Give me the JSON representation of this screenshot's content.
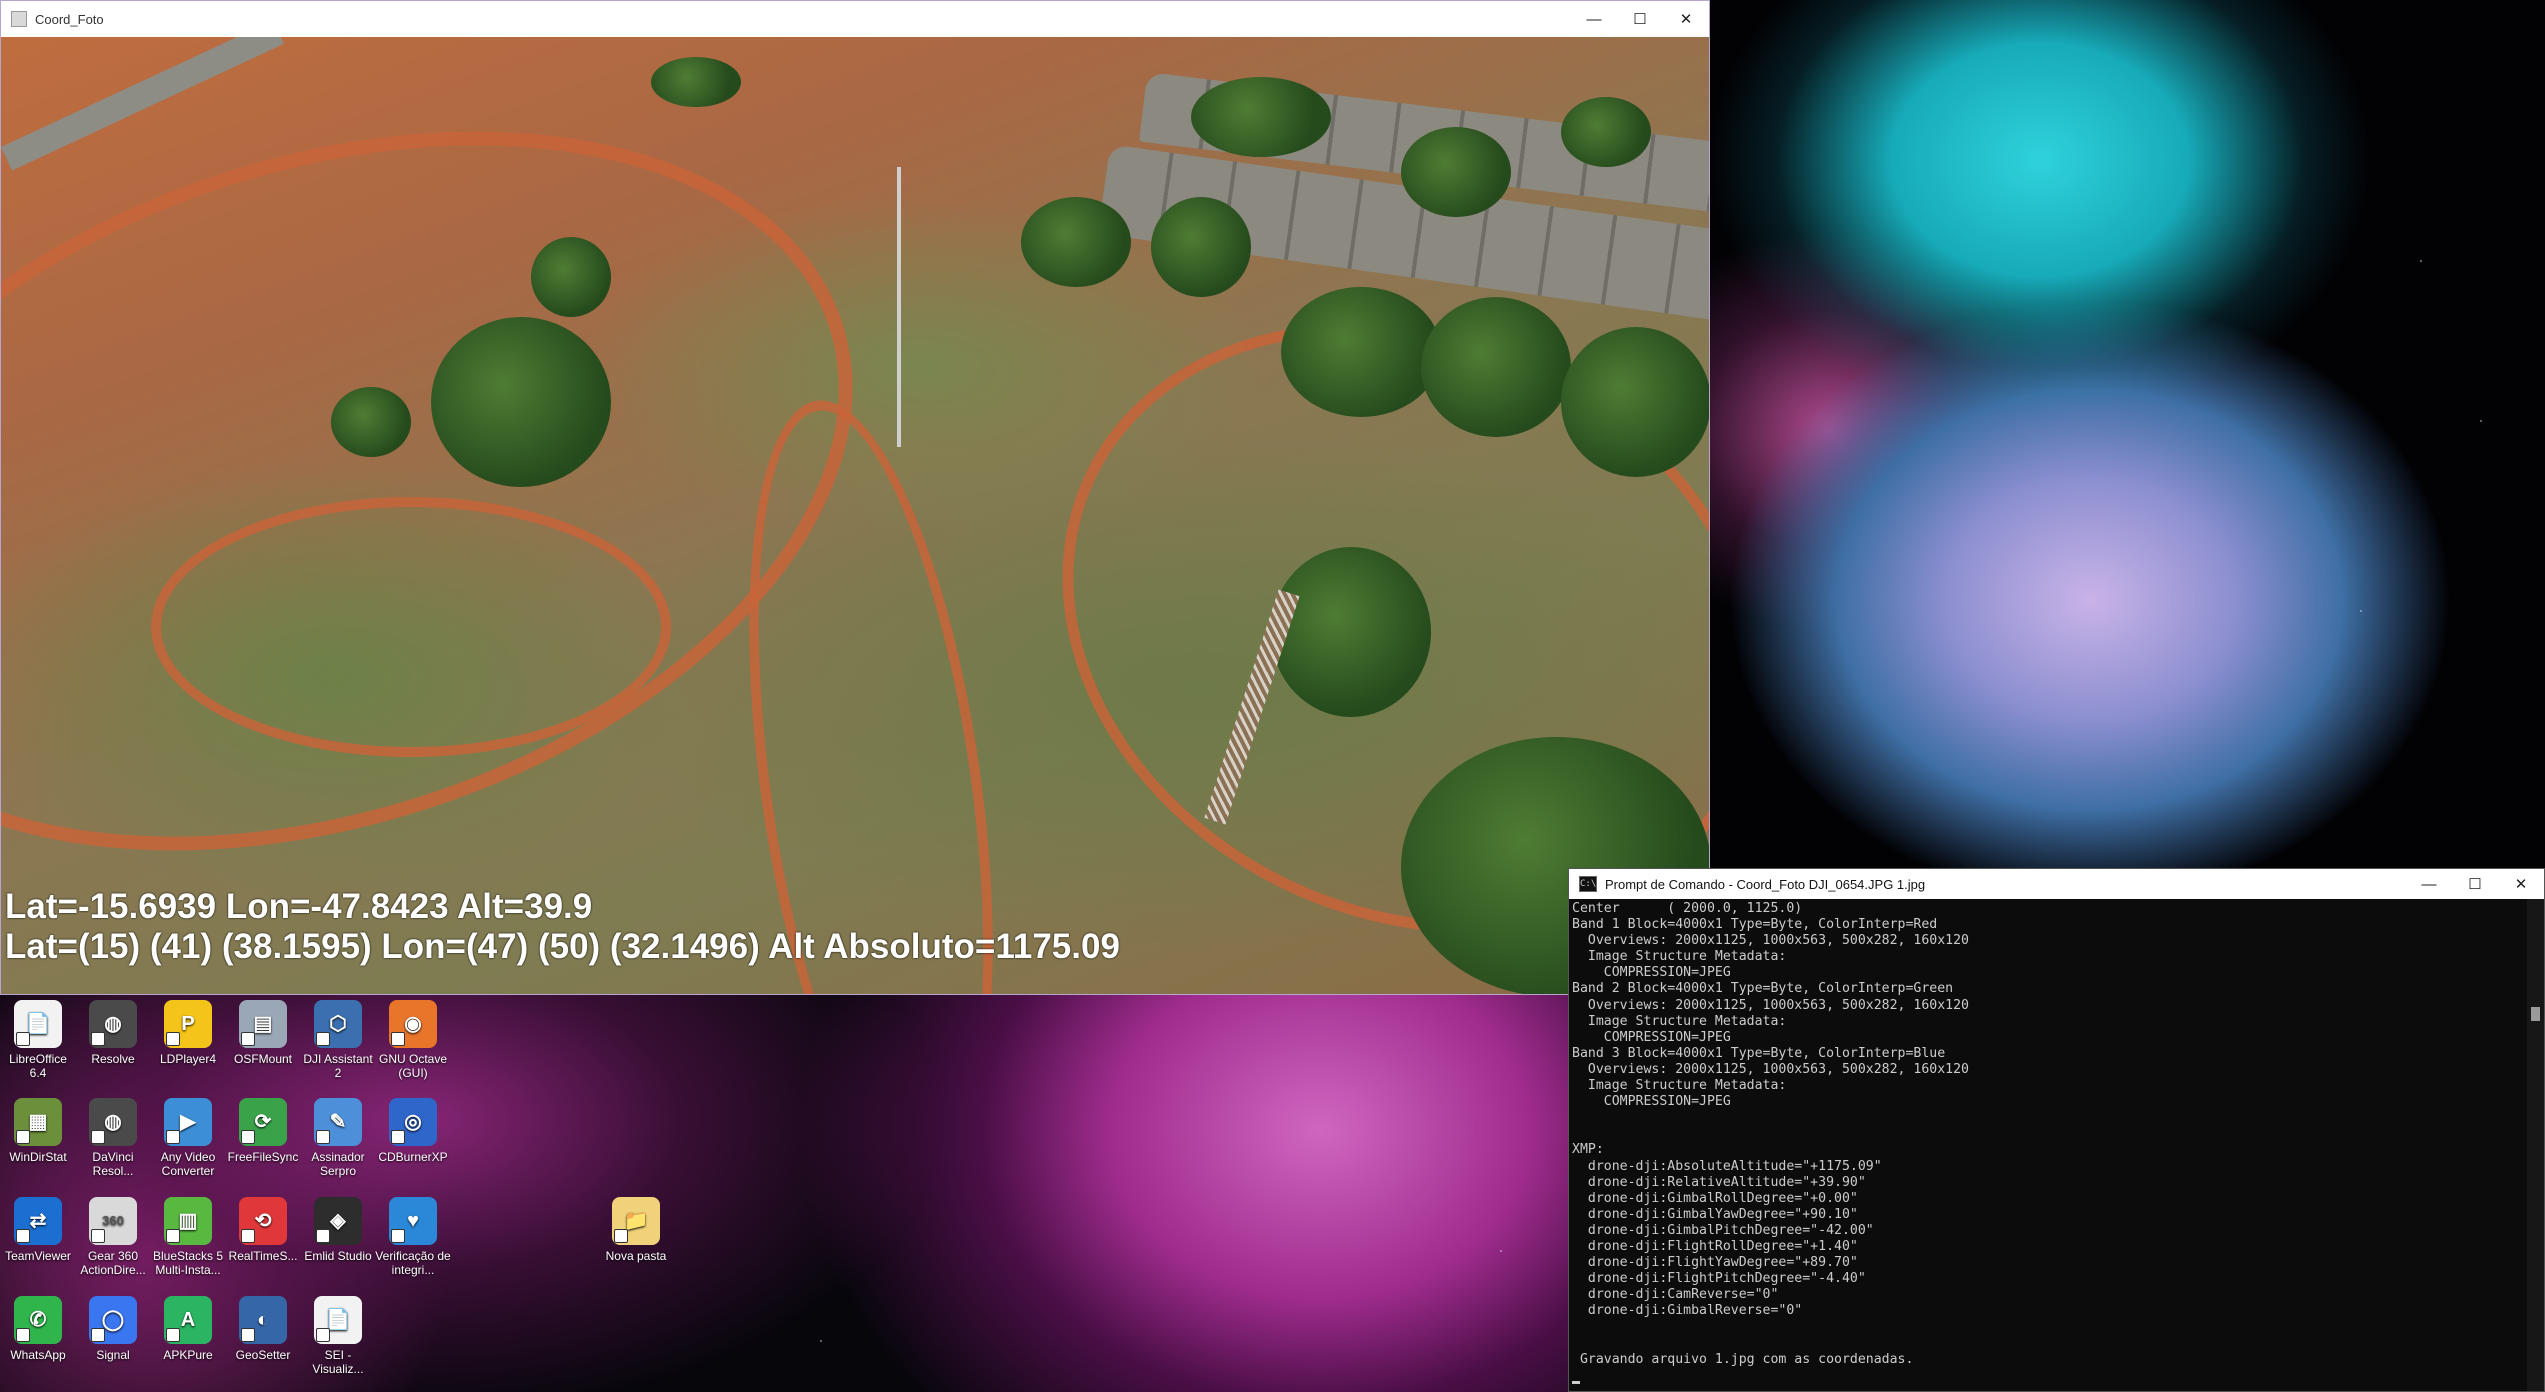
{
  "photo_window": {
    "title": "Coord_Foto",
    "overlay_line1": "Lat=-15.6939 Lon=-47.8423 Alt=39.9",
    "overlay_line2": "Lat=(15) (41) (38.1595) Lon=(47) (50) (32.1496) Alt Absoluto=1175.09"
  },
  "window_controls": {
    "minimize": "—",
    "maximize": "☐",
    "close": "✕"
  },
  "desktop_icons": [
    {
      "label": "LibreOffice 6.4",
      "name": "libreoffice-icon",
      "color": "#f2f2f2",
      "glyph": "📄"
    },
    {
      "label": "Resolve",
      "name": "resolve-icon",
      "color": "#4a4a4a",
      "glyph": "◍"
    },
    {
      "label": "LDPlayer4",
      "name": "ldplayer-icon",
      "color": "#f4c41a",
      "glyph": "P"
    },
    {
      "label": "OSFMount",
      "name": "osfmount-icon",
      "color": "#9aa7b6",
      "glyph": "▤"
    },
    {
      "label": "DJI Assistant 2",
      "name": "dji-assistant-icon",
      "color": "#3b6fb0",
      "glyph": "⬡"
    },
    {
      "label": "GNU Octave (GUI)",
      "name": "gnu-octave-icon",
      "color": "#e8752a",
      "glyph": "◉"
    },
    {
      "label": "WinDirStat",
      "name": "windirstat-icon",
      "color": "#6b8f3a",
      "glyph": "▦"
    },
    {
      "label": "DaVinci Resol...",
      "name": "davinci-resolve-icon",
      "color": "#4a4a4a",
      "glyph": "◍"
    },
    {
      "label": "Any Video Converter",
      "name": "any-video-converter-icon",
      "color": "#3c8fd6",
      "glyph": "▶"
    },
    {
      "label": "FreeFileSync",
      "name": "freefilesync-icon",
      "color": "#3aa34a",
      "glyph": "⟳"
    },
    {
      "label": "Assinador Serpro",
      "name": "assinador-serpro-icon",
      "color": "#4d8fd8",
      "glyph": "✎"
    },
    {
      "label": "CDBurnerXP",
      "name": "cdburnerxp-icon",
      "color": "#2f66c9",
      "glyph": "◎"
    },
    {
      "label": "TeamViewer",
      "name": "teamviewer-icon",
      "color": "#1b6fd1",
      "glyph": "⇄"
    },
    {
      "label": "Gear 360 ActionDire...",
      "name": "gear360-icon",
      "color": "#d9d9d9",
      "glyph": "360"
    },
    {
      "label": "BlueStacks 5 Multi-Insta...",
      "name": "bluestacks-icon",
      "color": "#58b840",
      "glyph": "▥"
    },
    {
      "label": "RealTimeS...",
      "name": "realtimesync-icon",
      "color": "#e0383a",
      "glyph": "⟲"
    },
    {
      "label": "Emlid Studio",
      "name": "emlid-studio-icon",
      "color": "#2d2d2d",
      "glyph": "◈"
    },
    {
      "label": "Verificação de integri...",
      "name": "verificacao-integridade-icon",
      "color": "#2b88d8",
      "glyph": "♥"
    },
    {
      "label": "WhatsApp",
      "name": "whatsapp-icon",
      "color": "#2fb54c",
      "glyph": "✆"
    },
    {
      "label": "Signal",
      "name": "signal-icon",
      "color": "#3a76f0",
      "glyph": "◯"
    },
    {
      "label": "APKPure",
      "name": "apkpure-icon",
      "color": "#2bb462",
      "glyph": "A"
    },
    {
      "label": "GeoSetter",
      "name": "geosetter-icon",
      "color": "#3566a8",
      "glyph": "◐"
    },
    {
      "label": "SEI - Visualiz...",
      "name": "sei-visualizador-icon",
      "color": "#f2f2f2",
      "glyph": "📄"
    },
    {
      "label": "Nova pasta",
      "name": "nova-pasta-folder-icon",
      "color": "#f0d27a",
      "glyph": "📁"
    }
  ],
  "cmd_window": {
    "title": "Prompt de Comando - Coord_Foto  DJI_0654.JPG 1.jpg",
    "icon_text": "C:\\",
    "lines": [
      "Center      ( 2000.0, 1125.0)",
      "Band 1 Block=4000x1 Type=Byte, ColorInterp=Red",
      "  Overviews: 2000x1125, 1000x563, 500x282, 160x120",
      "  Image Structure Metadata:",
      "    COMPRESSION=JPEG",
      "Band 2 Block=4000x1 Type=Byte, ColorInterp=Green",
      "  Overviews: 2000x1125, 1000x563, 500x282, 160x120",
      "  Image Structure Metadata:",
      "    COMPRESSION=JPEG",
      "Band 3 Block=4000x1 Type=Byte, ColorInterp=Blue",
      "  Overviews: 2000x1125, 1000x563, 500x282, 160x120",
      "  Image Structure Metadata:",
      "    COMPRESSION=JPEG",
      "",
      "",
      "XMP:",
      "  drone-dji:AbsoluteAltitude=\"+1175.09\"",
      "  drone-dji:RelativeAltitude=\"+39.90\"",
      "  drone-dji:GimbalRollDegree=\"+0.00\"",
      "  drone-dji:GimbalYawDegree=\"+90.10\"",
      "  drone-dji:GimbalPitchDegree=\"-42.00\"",
      "  drone-dji:FlightRollDegree=\"+1.40\"",
      "  drone-dji:FlightYawDegree=\"+89.70\"",
      "  drone-dji:FlightPitchDegree=\"-4.40\"",
      "  drone-dji:CamReverse=\"0\"",
      "  drone-dji:GimbalReverse=\"0\"",
      "",
      "",
      " Gravando arquivo 1.jpg com as coordenadas."
    ]
  }
}
